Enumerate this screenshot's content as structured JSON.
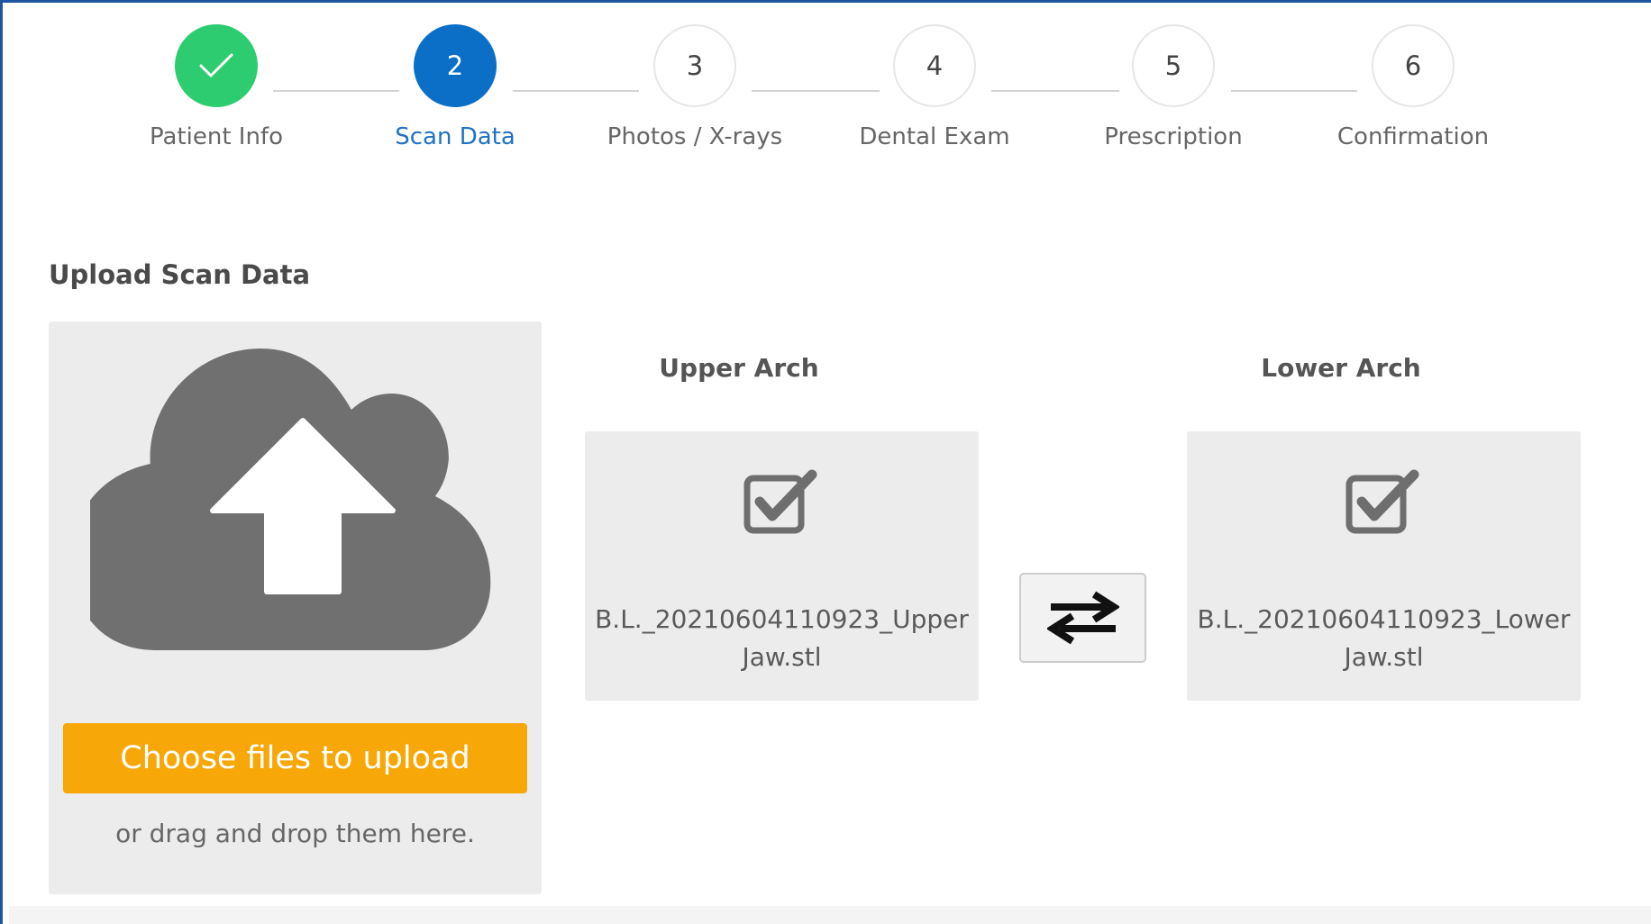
{
  "stepper": {
    "steps": [
      {
        "number": "",
        "label": "Patient Info",
        "state": "done"
      },
      {
        "number": "2",
        "label": "Scan Data",
        "state": "active"
      },
      {
        "number": "3",
        "label": "Photos / X-rays",
        "state": "pending"
      },
      {
        "number": "4",
        "label": "Dental Exam",
        "state": "pending"
      },
      {
        "number": "5",
        "label": "Prescription",
        "state": "pending"
      },
      {
        "number": "6",
        "label": "Confirmation",
        "state": "pending"
      }
    ]
  },
  "upload": {
    "section_title": "Upload Scan Data",
    "button_label": "Choose files to upload",
    "drag_text": "or drag and drop them here.",
    "icon": "cloud-upload-icon"
  },
  "upper_arch": {
    "label": "Upper Arch",
    "file_line1": "B.L._20210604110923_Upper",
    "file_line2": "Jaw.stl",
    "icon": "checked-box-icon"
  },
  "lower_arch": {
    "label": "Lower Arch",
    "file_line1": "B.L._20210604110923_Lower",
    "file_line2": "Jaw.stl",
    "icon": "checked-box-icon"
  },
  "swap": {
    "icon": "swap-arrows-icon"
  },
  "colors": {
    "done": "#2ecc71",
    "active": "#0b6fc7",
    "active_label": "#1f72c4",
    "upload_button": "#f7a707",
    "frame": "#1f55a0"
  }
}
